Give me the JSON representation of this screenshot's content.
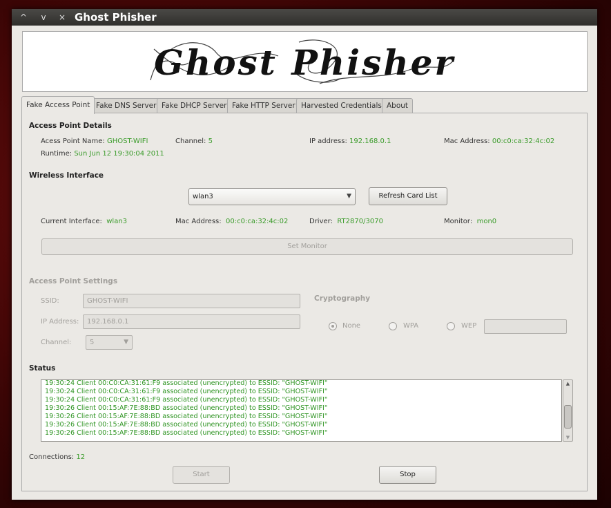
{
  "window": {
    "title": "Ghost Phisher",
    "controls": {
      "minimize": "^",
      "maximize": "v",
      "close": "×"
    }
  },
  "banner": {
    "text": "Ghost Phisher"
  },
  "tabs": [
    {
      "label": "Fake Access Point",
      "active": true
    },
    {
      "label": "Fake DNS Server"
    },
    {
      "label": "Fake DHCP Server"
    },
    {
      "label": "Fake HTTP Server"
    },
    {
      "label": "Harvested Credentials"
    },
    {
      "label": "About"
    }
  ],
  "ap_details": {
    "heading": "Access Point Details",
    "name_label": "Acess Point Name:",
    "name_value": "GHOST-WIFI",
    "channel_label": "Channel:",
    "channel_value": "5",
    "ip_label": "IP address:",
    "ip_value": "192.168.0.1",
    "mac_label": "Mac Address:",
    "mac_value": "00:c0:ca:32:4c:02",
    "runtime_label": "Runtime:",
    "runtime_value": "Sun Jun 12 19:30:04 2011"
  },
  "wireless": {
    "heading": "Wireless Interface",
    "selected_interface": "wlan3",
    "refresh_label": "Refresh Card List",
    "current_label": "Current Interface:",
    "current_value": "wlan3",
    "mac_label": "Mac Address:",
    "mac_value": "00:c0:ca:32:4c:02",
    "driver_label": "Driver:",
    "driver_value": "RT2870/3070",
    "monitor_label": "Monitor:",
    "monitor_value": "mon0",
    "set_monitor_label": "Set Monitor"
  },
  "ap_settings": {
    "heading": "Access Point Settings",
    "ssid_label": "SSID:",
    "ssid_value": "GHOST-WIFI",
    "ip_label": "IP Address:",
    "ip_value": "192.168.0.1",
    "channel_label": "Channel:",
    "channel_value": "5",
    "crypto_heading": "Cryptography",
    "crypto_options": [
      "None",
      "WPA",
      "WEP"
    ],
    "crypto_selected": "None",
    "key_value": ""
  },
  "status": {
    "heading": "Status",
    "log": [
      "19:30:24 Client 00:C0:CA:31:61:F9 associated (unencrypted) to ESSID: \"GHOST-WIFI\"",
      "19:30:24 Client 00:C0:CA:31:61:F9 associated (unencrypted) to ESSID: \"GHOST-WIFI\"",
      "19:30:24 Client 00:C0:CA:31:61:F9 associated (unencrypted) to ESSID: \"GHOST-WIFI\"",
      "19:30:26 Client 00:15:AF:7E:88:BD associated (unencrypted) to ESSID: \"GHOST-WIFI\"",
      "19:30:26 Client 00:15:AF:7E:88:BD associated (unencrypted) to ESSID: \"GHOST-WIFI\"",
      "19:30:26 Client 00:15:AF:7E:88:BD associated (unencrypted) to ESSID: \"GHOST-WIFI\"",
      "19:30:26 Client 00:15:AF:7E:88:BD associated (unencrypted) to ESSID: \"GHOST-WIFI\""
    ],
    "connections_label": "Connections:",
    "connections_value": "12"
  },
  "actions": {
    "start_label": "Start",
    "stop_label": "Stop"
  },
  "colors": {
    "value_green": "#3a9b2a",
    "background_red": "#6a0d0d",
    "titlebar": "#3c3b37"
  }
}
